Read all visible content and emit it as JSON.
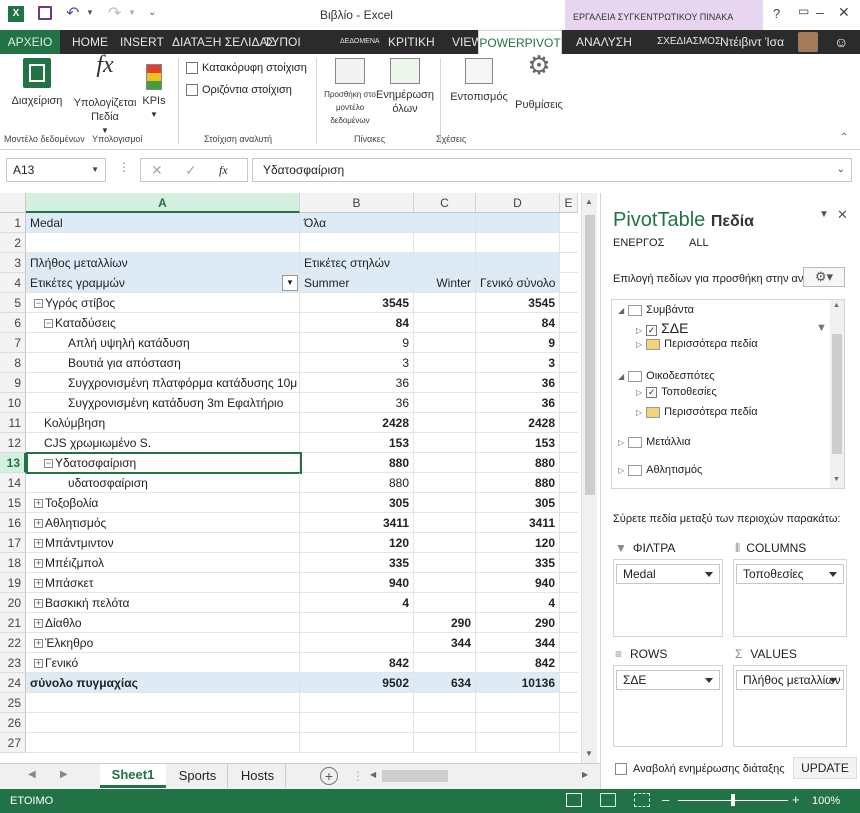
{
  "window": {
    "title": "Βιβλίο - Excel",
    "context_tab": "ΕΡΓΑΛΕΙΑ ΣΥΓΚΕΝΤΡΩΤΙΚΟΥ ΠΙΝΑΚΑ",
    "help": "?"
  },
  "tabs": [
    "ΑΡΧΕΙΟ",
    "HOME",
    "INSERT",
    "ΔΙΑΤΑΞΗ ΣΕΛΙΔΑΣ",
    "ΤΥΠΟΙ",
    "ΔΕΔΟΜΕΝΑ",
    "ΚΡΙΤΙΚΗ",
    "VIEW",
    "POWERPIVOT",
    "ΑΝΑΛΥΣΗ",
    "ΣΧΕΔΙΑΣΜΟΣ"
  ],
  "user": {
    "name": "Ντέιβιντ Ίσα"
  },
  "ribbon": {
    "manage": "Διαχείριση",
    "calc_fields_1": "Υπολογίζεται",
    "calc_fields_2": "Πεδία",
    "kpis": "KPIs",
    "align_vertical": "Κατακόρυφη στοίχιση",
    "align_horizontal": "Οριζόντια στοίχιση",
    "add_to_model_1": "Προσθήκη στο",
    "add_to_model_2": "μοντέλο δεδομένων",
    "refresh_all_1": "Ενημέρωση",
    "refresh_all_2": "όλων",
    "detect": "Εντοπισμός",
    "settings": "Ρυθμίσεις",
    "grp_model": "Μοντέλο δεδομένων",
    "grp_calc": "Υπολογισμοί",
    "grp_align": "Στοίχιση αναλυτή",
    "grp_tables": "Πίνακες",
    "grp_rel": "Σχέσεις"
  },
  "formula": {
    "namebox": "A13",
    "fx": "fx",
    "value": "Υδατοσφαίριση"
  },
  "columns": [
    "A",
    "B",
    "C",
    "D",
    "E"
  ],
  "rows": [
    {
      "n": "1",
      "a": "Medal",
      "b": "Όλα",
      "c": "",
      "d": ""
    },
    {
      "n": "2",
      "a": "",
      "b": "",
      "c": "",
      "d": ""
    },
    {
      "n": "3",
      "a": "Πλήθος μεταλλίων",
      "b": "Ετικέτες στηλών",
      "c": "",
      "d": ""
    },
    {
      "n": "4",
      "a": "Ετικέτες γραμμών",
      "b": "Summer",
      "c": "Winter",
      "d": "Γενικό σύνολο"
    },
    {
      "n": "5",
      "a": "Υγρός στίβος",
      "b": "3545",
      "c": "",
      "d": "3545"
    },
    {
      "n": "6",
      "a": "Καταδύσεις",
      "b": "84",
      "c": "",
      "d": "84"
    },
    {
      "n": "7",
      "a": "Απλή υψηλή κατάδυση",
      "b": "9",
      "c": "",
      "d": "9"
    },
    {
      "n": "8",
      "a": "Βουτιά για απόσταση",
      "b": "3",
      "c": "",
      "d": "3"
    },
    {
      "n": "9",
      "a": "Συγχρονισμένη πλατφόρμα κατάδυσης 10μ",
      "b": "36",
      "c": "",
      "d": "36"
    },
    {
      "n": "10",
      "a": "Συγχρονισμένη κατάδυση 3m Εφαλτήριο",
      "b": "36",
      "c": "",
      "d": "36"
    },
    {
      "n": "11",
      "a": "Κολύμβηση",
      "b": "2428",
      "c": "",
      "d": "2428"
    },
    {
      "n": "12",
      "a": "CJS χρωμιωμένο S.",
      "b": "153",
      "c": "",
      "d": "153"
    },
    {
      "n": "13",
      "a": "Υδατοσφαίριση",
      "b": "880",
      "c": "",
      "d": "880"
    },
    {
      "n": "14",
      "a": "υδατοσφαίριση",
      "b": "880",
      "c": "",
      "d": "880"
    },
    {
      "n": "15",
      "a": "Τοξοβολία",
      "b": "305",
      "c": "",
      "d": "305"
    },
    {
      "n": "16",
      "a": "Αθλητισμός",
      "b": "3411",
      "c": "",
      "d": "3411"
    },
    {
      "n": "17",
      "a": "Μπάντμιντον",
      "b": "120",
      "c": "",
      "d": "120"
    },
    {
      "n": "18",
      "a": "Μπέιζμπολ",
      "b": "335",
      "c": "",
      "d": "335"
    },
    {
      "n": "19",
      "a": "Μπάσκετ",
      "b": "940",
      "c": "",
      "d": "940"
    },
    {
      "n": "20",
      "a": "Βασκική πελότα",
      "b": "4",
      "c": "",
      "d": "4"
    },
    {
      "n": "21",
      "a": "Δίαθλο",
      "b": "",
      "c": "290",
      "d": "290"
    },
    {
      "n": "22",
      "a": "Έλκηθρο",
      "b": "",
      "c": "344",
      "d": "344"
    },
    {
      "n": "23",
      "a": "Γενικό",
      "b": "842",
      "c": "",
      "d": "842"
    },
    {
      "n": "24",
      "a": "σύνολο πυγμαχίας",
      "b": "9502",
      "c": "634",
      "d": "10136"
    },
    {
      "n": "25",
      "a": "",
      "b": "",
      "c": "",
      "d": ""
    },
    {
      "n": "26",
      "a": "",
      "b": "",
      "c": "",
      "d": ""
    },
    {
      "n": "27",
      "a": "",
      "b": "",
      "c": "",
      "d": ""
    }
  ],
  "sheets": [
    "Sheet1",
    "Sports",
    "Hosts"
  ],
  "status": {
    "ready": "ΕΤΟΙΜΟ",
    "zoom": "100%"
  },
  "panel": {
    "title_1": "PivotTable",
    "title_2": "Πεδία",
    "tab_active": "ΕΝΕΡΓΟΣ",
    "tab_all": "ALL",
    "choose": "Επιλογή πεδίων για προσθήκη στην αναφορά:",
    "tree": [
      {
        "label": "Συμβάντα",
        "level": 0
      },
      {
        "label": "ΣΔΕ",
        "level": 1
      },
      {
        "label": "Περισσότερα πεδία",
        "level": 1
      },
      {
        "label": "Οικοδεσπότες",
        "level": 0
      },
      {
        "label": "Τοποθεσίες",
        "level": 1
      },
      {
        "label": "Περισσότερα πεδία",
        "level": 1
      },
      {
        "label": "Μετάλλια",
        "level": 0
      },
      {
        "label": "Αθλητισμός",
        "level": 0
      }
    ],
    "drag": "Σύρετε πεδία μεταξύ των περιοχών παρακάτω:",
    "filters": "ΦΙΛΤΡΑ",
    "columns": "COLUMNS",
    "rows": "ROWS",
    "values": "VALUES",
    "filter_val": "Medal",
    "col_val": "Τοποθεσίες",
    "row_val": "ΣΔΕ",
    "values_val": "Πλήθος μεταλλίων",
    "defer": "Αναβολή ενημέρωσης διάταξης",
    "update": "UPDATE"
  },
  "colors": {
    "accent": "#217346",
    "header_fill": "#ddebf7",
    "selected_col": "#d3f0e0"
  }
}
